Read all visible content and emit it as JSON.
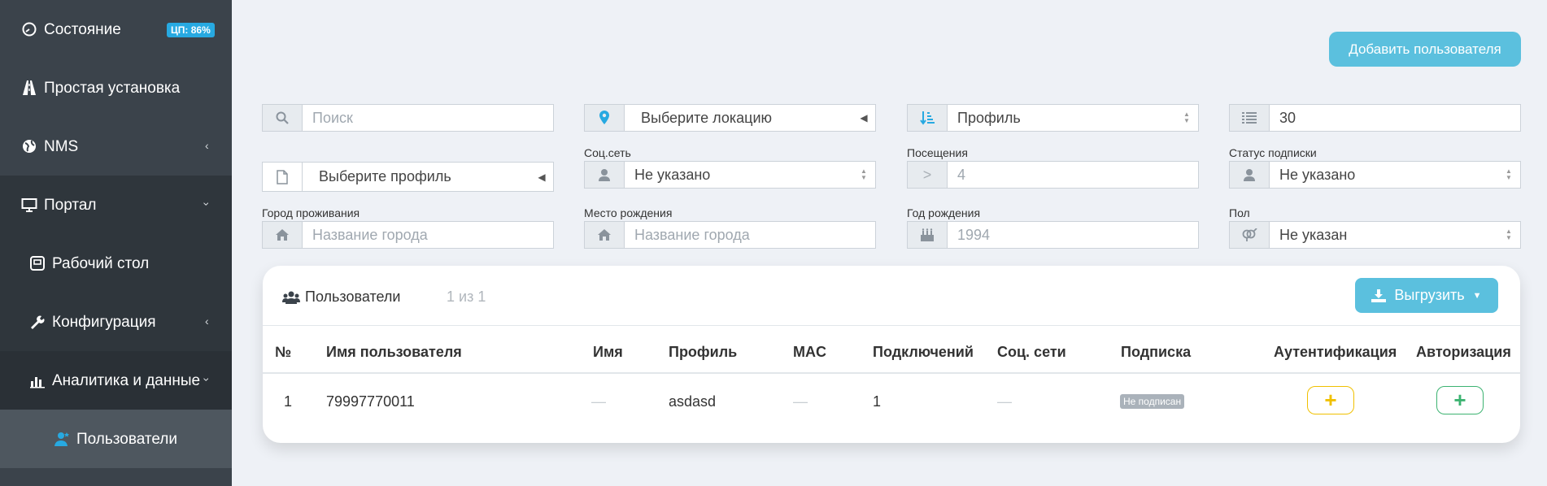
{
  "sidebar": {
    "items": [
      {
        "label": "Состояние",
        "icon": "dashboard-icon",
        "badge": "ЦП: 86%"
      },
      {
        "label": "Простая установка",
        "icon": "road-icon"
      },
      {
        "label": "NMS",
        "icon": "globe-icon",
        "chevron": "‹"
      },
      {
        "label": "Портал",
        "icon": "monitor-icon",
        "chevron": "›"
      },
      {
        "label": "Рабочий стол",
        "icon": "desktop-icon"
      },
      {
        "label": "Конфигурация",
        "icon": "wrench-icon",
        "chevron": "‹"
      },
      {
        "label": "Аналитика и данные",
        "icon": "bar-chart-icon",
        "chevron": "›"
      },
      {
        "label": "Пользователи",
        "icon": "user-icon"
      }
    ]
  },
  "toolbar": {
    "add_user_label": "Добавить пользователя"
  },
  "filters": {
    "search": {
      "placeholder": "Поиск"
    },
    "location": {
      "value": "Выберите локацию"
    },
    "profile_sort": {
      "value": "Профиль"
    },
    "per_page": {
      "value": "30"
    },
    "profile_select": {
      "value": "Выберите профиль"
    },
    "social": {
      "label": "Соц.сеть",
      "value": "Не указано"
    },
    "visits": {
      "label": "Посещения",
      "prefix": ">",
      "placeholder": "4"
    },
    "subscription": {
      "label": "Статус подписки",
      "value": "Не указано"
    },
    "city": {
      "label": "Город проживания",
      "placeholder": "Название города"
    },
    "birthplace": {
      "label": "Место рождения",
      "placeholder": "Название города"
    },
    "birthyear": {
      "label": "Год рождения",
      "placeholder": "1994"
    },
    "gender": {
      "label": "Пол",
      "value": "Не указан"
    }
  },
  "users_card": {
    "title": "Пользователи",
    "count": "1 из 1",
    "export_label": "Выгрузить",
    "columns": [
      "№",
      "Имя пользователя",
      "Имя",
      "Профиль",
      "MAC",
      "Подключений",
      "Соц. сети",
      "Подписка",
      "Аутентификация",
      "Авторизация"
    ],
    "rows": [
      {
        "num": "1",
        "username": "79997770011",
        "name": "—",
        "profile": "asdasd",
        "mac": "—",
        "connections": "1",
        "social": "—",
        "subscription": "Не подписан",
        "auth_action": "+",
        "authz_action": "+"
      }
    ]
  },
  "colors": {
    "sidebar": "#3b434b",
    "accent": "#5bc0de",
    "badge": "#27a9e1",
    "auth_yellow": "#f0c000",
    "authz_green": "#3cb371"
  }
}
